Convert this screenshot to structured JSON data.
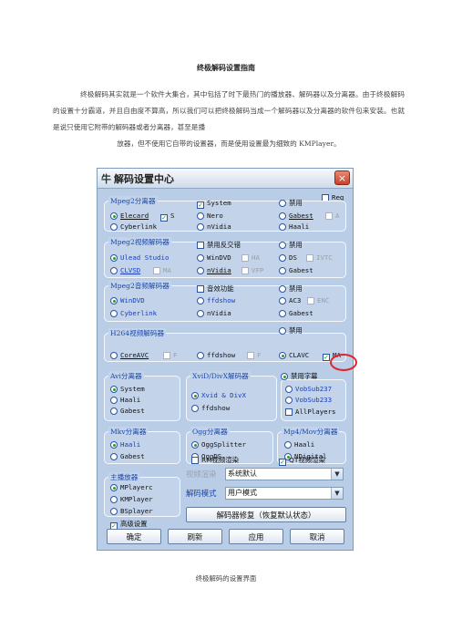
{
  "doc": {
    "title": "终极解码设置指南",
    "paragraph": "终极解码其实就是一个软件大集合，其中包括了时下最热门的播放器、解码器以及分离器。由于终极解码的设置十分霸道，并且自由度不算高，所以我们可以把终极解码当成一个解码器以及分离器的软件包来安装。也就是说只使用它附带的解码器或者分离器，甚至是播",
    "paragraph_end": "放器，但不使用它自带的设置器，而是使用设置最为细致的 KMPlayer。",
    "caption": "终极解码的设置界面"
  },
  "dialog": {
    "title_icon": "牛",
    "title": "解码设置中心",
    "close": "×",
    "reg": "Reg",
    "groups": {
      "mpeg2_splitter": {
        "title": "Mpeg2分离器",
        "opts": [
          "Elecard",
          "S",
          "Cyberlink",
          "System",
          "Nero",
          "nVidia",
          "禁用",
          "Gabest",
          "A",
          "Haali"
        ]
      },
      "mpeg2_video": {
        "title": "Mpeg2视频解码器",
        "opts": [
          "Ulead Studio",
          "CLVSD",
          "MA",
          "禁用反交错",
          "WinDVD",
          "HA",
          "nVidia",
          "VFP",
          "禁用",
          "DS",
          "IVTC",
          "Gabest"
        ]
      },
      "mpeg2_audio": {
        "title": "Mpeg2音频解码器",
        "opts": [
          "WinDVD",
          "Cyberlink",
          "音效功能",
          "ffdshow",
          "nVidia",
          "禁用",
          "AC3",
          "ENC",
          "Gabest"
        ]
      },
      "h264": {
        "title": "H264视频解码器",
        "opts": [
          "CoreAVC",
          "F",
          "ffdshow",
          "F",
          "禁用",
          "CLAVC",
          "MA"
        ]
      },
      "avi_splitter": {
        "title": "Avi分离器",
        "opts": [
          "System",
          "Haali",
          "Gabest"
        ]
      },
      "xvid": {
        "title": "XviD/DivX解码器",
        "opts": [
          "Xvid & DivX",
          "ffdshow"
        ]
      },
      "subtitle": {
        "opts": [
          "禁用字幕",
          "VobSub237",
          "VobSub233",
          "AllPlayers"
        ]
      },
      "mkv_splitter": {
        "title": "Mkv分离器",
        "opts": [
          "Haali",
          "Gabest"
        ]
      },
      "ogg_splitter": {
        "title": "Ogg分离器",
        "opts": [
          "OggSplitter",
          "OggDS"
        ]
      },
      "mp4_splitter": {
        "title": "Mp4/Mov分离器",
        "opts": [
          "Haali",
          "NDigital"
        ]
      },
      "player": {
        "title": "主播放器",
        "opts": [
          "MPlayerc",
          "KMPlayer",
          "BSplayer"
        ]
      }
    },
    "rm_render": "RM视频渲染",
    "qt_render": "QT视频渲染",
    "video_render_label": "视频渲染",
    "video_render_value": "系统默认",
    "decode_mode_label": "解码模式",
    "decode_mode_value": "用户模式",
    "advanced": "高级设置",
    "repair": "解码器修复（恢复默认状态）",
    "ok": "确定",
    "refresh": "刷新",
    "apply": "应用",
    "cancel": "取消"
  }
}
